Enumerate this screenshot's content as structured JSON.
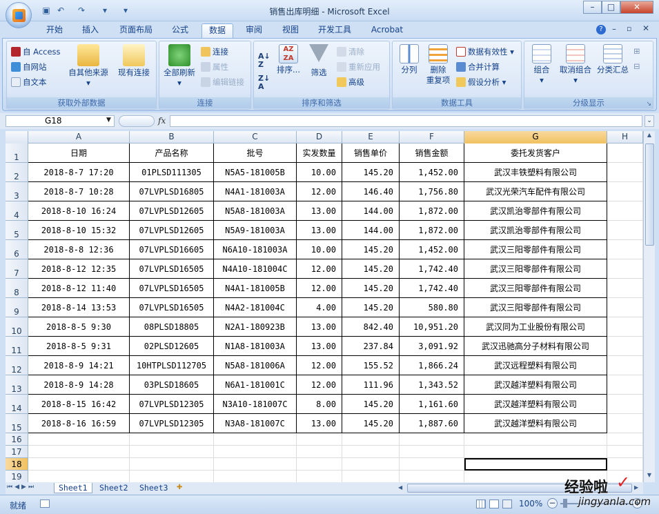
{
  "window": {
    "title": "销售出库明细 - Microsoft Excel",
    "minimize": "–",
    "maximize": "□",
    "close": "✕"
  },
  "quick_access": [
    "save-icon",
    "undo-icon",
    "redo-icon",
    "customize-icon"
  ],
  "tabs": [
    "开始",
    "插入",
    "页面布局",
    "公式",
    "数据",
    "审阅",
    "视图",
    "开发工具",
    "Acrobat"
  ],
  "active_tab": "数据",
  "ribbon": {
    "external": {
      "access": "自 Access",
      "web": "自网站",
      "text": "自文本",
      "other": "自其他来源",
      "existing": "现有连接",
      "label": "获取外部数据"
    },
    "connections": {
      "refresh_all": "全部刷新",
      "connections": "连接",
      "properties": "属性",
      "edit_links": "编辑链接",
      "label": "连接"
    },
    "sort_filter": {
      "sort": "排序...",
      "filter": "筛选",
      "clear": "清除",
      "reapply": "重新应用",
      "advanced": "高级",
      "label": "排序和筛选"
    },
    "data_tools": {
      "text_to_columns": "分列",
      "remove_duplicates_1": "删除",
      "remove_duplicates_2": "重复项",
      "validation": "数据有效性",
      "consolidate": "合并计算",
      "what_if": "假设分析",
      "label": "数据工具"
    },
    "outline": {
      "group": "组合",
      "ungroup": "取消组合",
      "subtotal": "分类汇总",
      "label": "分级显示"
    }
  },
  "formula_bar": {
    "name_box": "G18",
    "fx": "fx",
    "formula": ""
  },
  "columns": [
    "A",
    "B",
    "C",
    "D",
    "E",
    "F",
    "G",
    "H"
  ],
  "selected_column": "G",
  "selected_row": "18",
  "headers": [
    "日期",
    "产品名称",
    "批号",
    "实发数量",
    "销售单价",
    "销售金额",
    "委托发货客户"
  ],
  "rows": [
    [
      "2018-8-7 17:20",
      "01PLSD111305",
      "N5A5-181005B",
      "10.00",
      "145.20",
      "1,452.00",
      "武汉丰铁塑料有限公司"
    ],
    [
      "2018-8-7 10:28",
      "07LVPLSD16805",
      "N4A1-181003A",
      "12.00",
      "146.40",
      "1,756.80",
      "武汉光荣汽车配件有限公司"
    ],
    [
      "2018-8-10 16:24",
      "07LVPLSD12605",
      "N5A8-181003A",
      "13.00",
      "144.00",
      "1,872.00",
      "武汉凯治零部件有限公司"
    ],
    [
      "2018-8-10 15:32",
      "07LVPLSD12605",
      "N5A9-181003A",
      "13.00",
      "144.00",
      "1,872.00",
      "武汉凯治零部件有限公司"
    ],
    [
      "2018-8-8 12:36",
      "07LVPLSD16605",
      "N6A10-181003A",
      "10.00",
      "145.20",
      "1,452.00",
      "武汉三阳零部件有限公司"
    ],
    [
      "2018-8-12 12:35",
      "07LVPLSD16505",
      "N4A10-181004C",
      "12.00",
      "145.20",
      "1,742.40",
      "武汉三阳零部件有限公司"
    ],
    [
      "2018-8-12 11:40",
      "07LVPLSD16505",
      "N4A1-181005B",
      "12.00",
      "145.20",
      "1,742.40",
      "武汉三阳零部件有限公司"
    ],
    [
      "2018-8-14 13:53",
      "07LVPLSD16505",
      "N4A2-181004C",
      "4.00",
      "145.20",
      "580.80",
      "武汉三阳零部件有限公司"
    ],
    [
      "2018-8-5 9:30",
      "08PLSD18805",
      "N2A1-180923B",
      "13.00",
      "842.40",
      "10,951.20",
      "武汉同为工业股份有限公司"
    ],
    [
      "2018-8-5 9:31",
      "02PLSD12605",
      "N1A8-181003A",
      "13.00",
      "237.84",
      "3,091.92",
      "武汉迅驰高分子材料有限公司"
    ],
    [
      "2018-8-9 14:21",
      "10HTPLSD112705",
      "N5A8-181006A",
      "12.00",
      "155.52",
      "1,866.24",
      "武汉远程塑料有限公司"
    ],
    [
      "2018-8-9 14:28",
      "03PLSD18605",
      "N6A1-181001C",
      "12.00",
      "111.96",
      "1,343.52",
      "武汉越洋塑料有限公司"
    ],
    [
      "2018-8-15 16:42",
      "07LVPLSD12305",
      "N3A10-181007C",
      "8.00",
      "145.20",
      "1,161.60",
      "武汉越洋塑料有限公司"
    ],
    [
      "2018-8-16 16:59",
      "07LVPLSD12305",
      "N3A8-181007C",
      "13.00",
      "145.20",
      "1,887.60",
      "武汉越洋塑料有限公司"
    ]
  ],
  "row_numbers": [
    "1",
    "2",
    "3",
    "4",
    "5",
    "6",
    "7",
    "8",
    "9",
    "10",
    "11",
    "12",
    "13",
    "14",
    "15",
    "16",
    "17",
    "18",
    "19"
  ],
  "sheets": [
    "Sheet1",
    "Sheet2",
    "Sheet3"
  ],
  "status": {
    "ready": "就绪",
    "zoom": "100%",
    "zoom_out": "−",
    "zoom_in": "+"
  },
  "watermark": {
    "text": "经验啦",
    "url": "jingyanla.com"
  }
}
